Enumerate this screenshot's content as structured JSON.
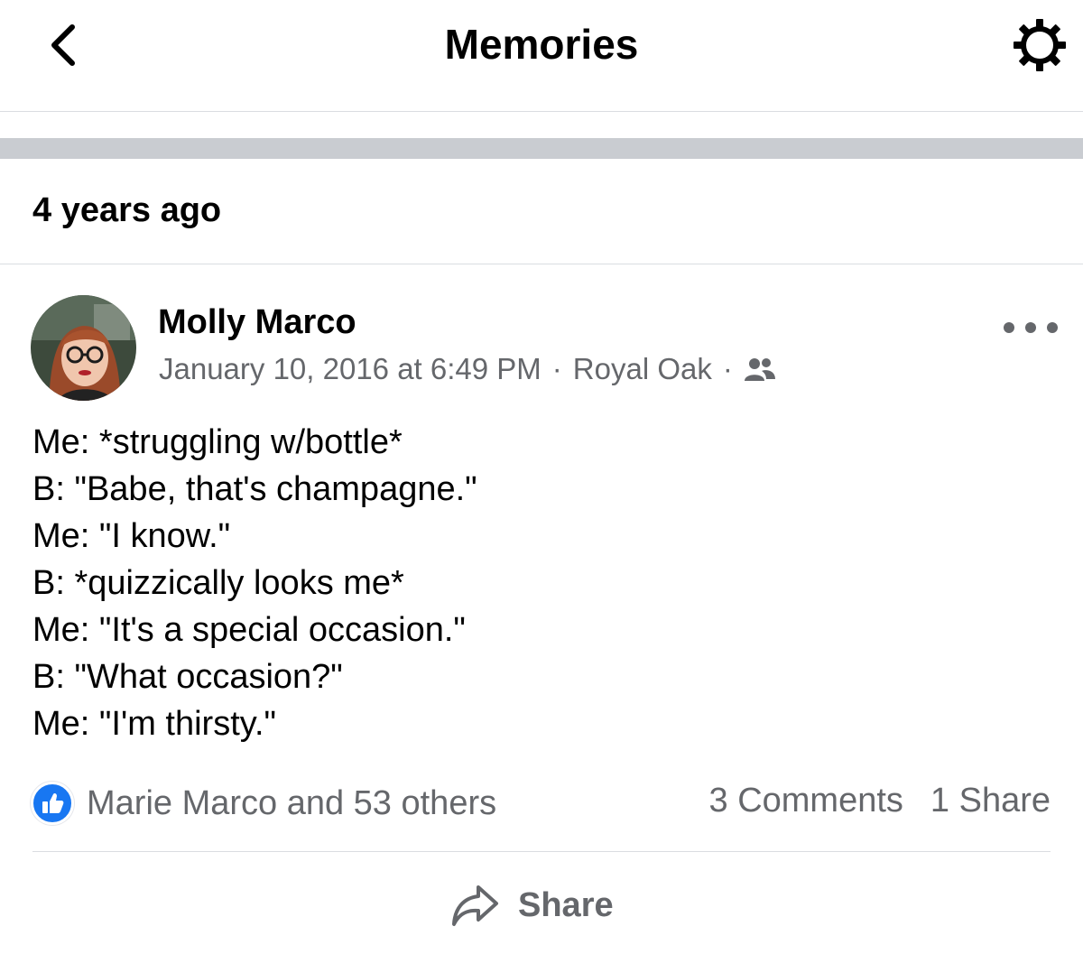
{
  "nav": {
    "title": "Memories",
    "back_icon": "chevron-left-icon",
    "settings_icon": "gear-icon"
  },
  "section": {
    "title": "4 years ago"
  },
  "post": {
    "author": "Molly Marco",
    "date": "January 10, 2016 at 6:49 PM",
    "separator": "·",
    "location": "Royal Oak",
    "audience_icon": "friends-icon",
    "more_icon": "more-options-icon",
    "lines": [
      "Me: *struggling w/bottle*",
      "B: \"Babe, that's champagne.\"",
      "Me: \"I know.\"",
      "B: *quizzically looks me*",
      "Me: \"It's a special occasion.\"",
      "B: \"What occasion?\"",
      "Me: \"I'm thirsty.\""
    ],
    "reactions_text": "Marie Marco and 53 others",
    "comments": "3 Comments",
    "shares": "1 Share",
    "share_button": "Share"
  },
  "colors": {
    "accent": "#1877f2",
    "secondary_text": "#65676b",
    "band": "#c9ccd1"
  }
}
